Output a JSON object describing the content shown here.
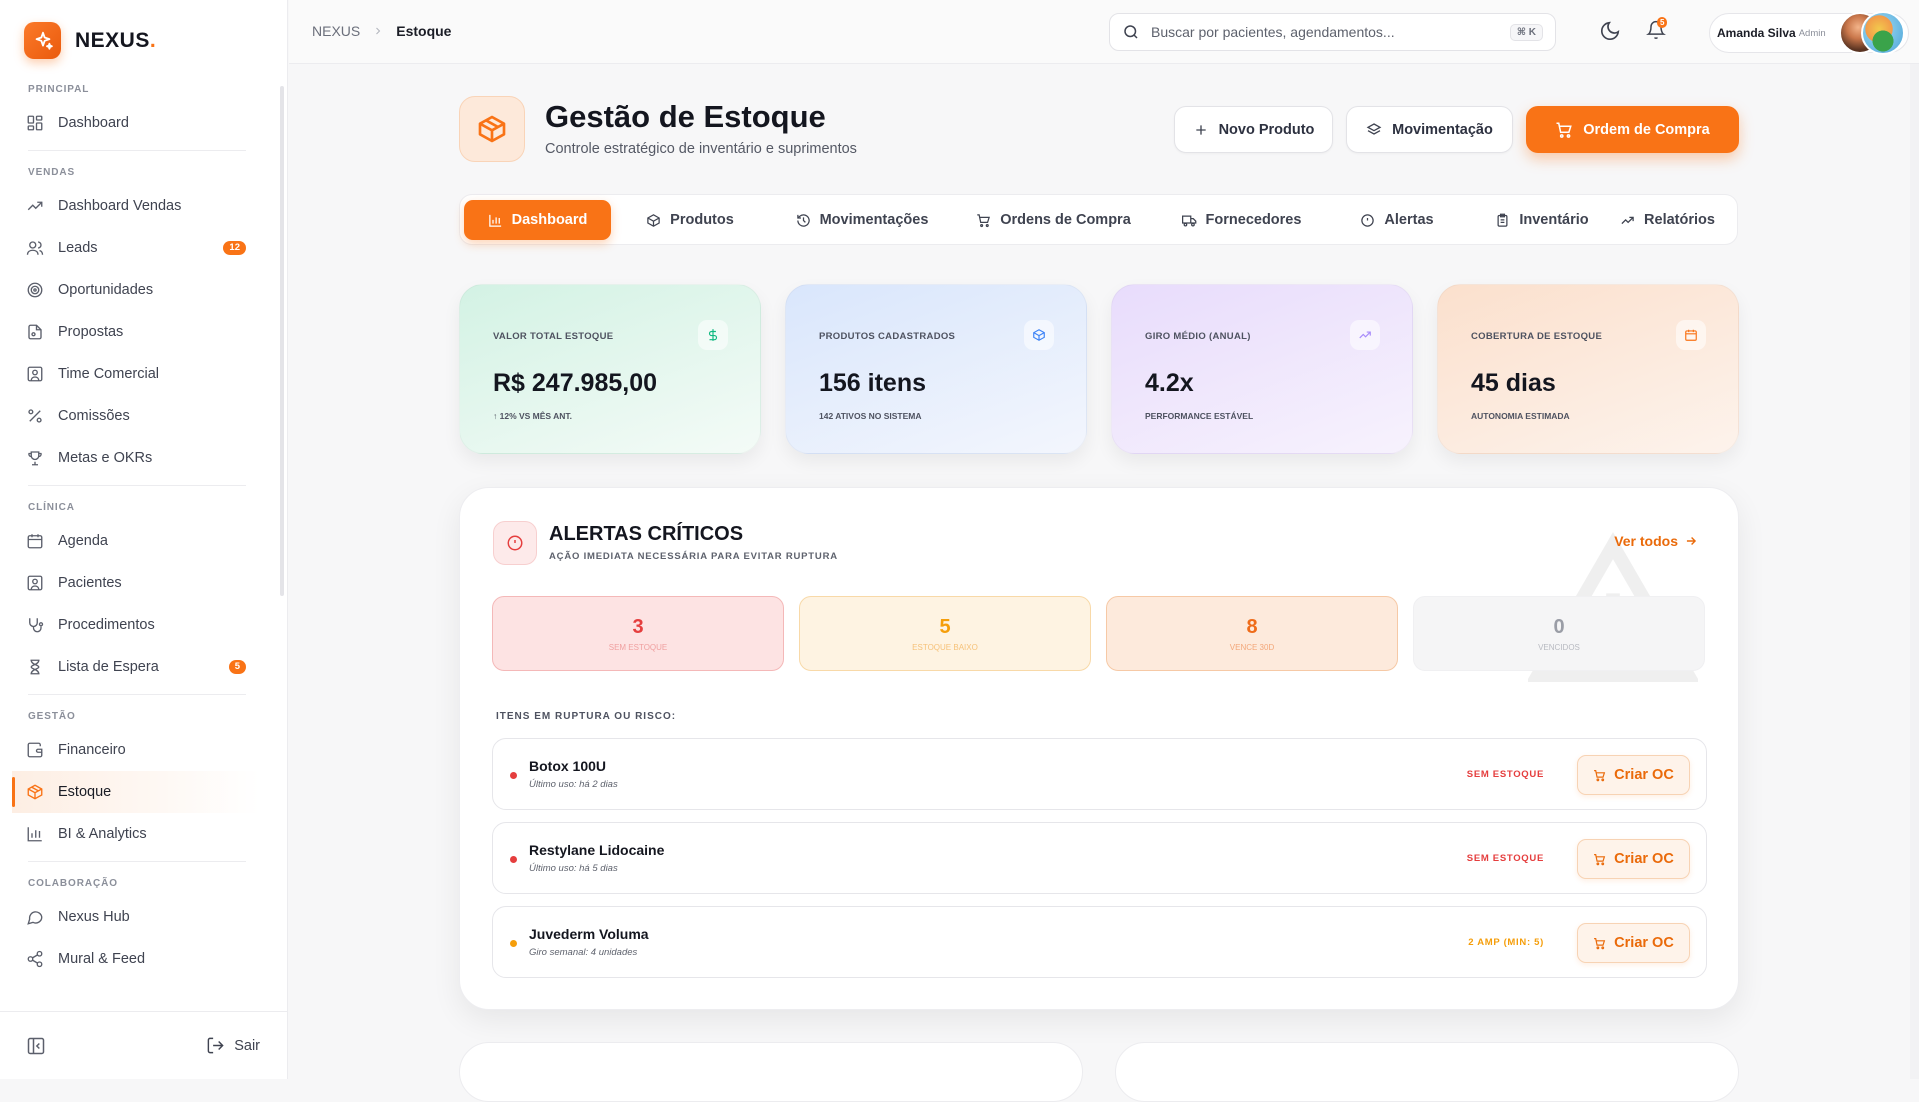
{
  "brand": {
    "name": "NEXUS",
    "dot": "."
  },
  "sidebar": {
    "sections": [
      {
        "label": "PRINCIPAL",
        "items": [
          {
            "label": "Dashboard",
            "icon": "dashboard-icon"
          }
        ]
      },
      {
        "label": "VENDAS",
        "items": [
          {
            "label": "Dashboard Vendas",
            "icon": "trending-up-icon"
          },
          {
            "label": "Leads",
            "icon": "users-icon",
            "badge": "12"
          },
          {
            "label": "Oportunidades",
            "icon": "target-icon"
          },
          {
            "label": "Propostas",
            "icon": "file-icon"
          },
          {
            "label": "Time Comercial",
            "icon": "contact-icon"
          },
          {
            "label": "Comissões",
            "icon": "percent-icon"
          },
          {
            "label": "Metas e OKRs",
            "icon": "trophy-icon"
          }
        ]
      },
      {
        "label": "CLÍNICA",
        "items": [
          {
            "label": "Agenda",
            "icon": "calendar-icon"
          },
          {
            "label": "Pacientes",
            "icon": "contact-icon"
          },
          {
            "label": "Procedimentos",
            "icon": "stethoscope-icon"
          },
          {
            "label": "Lista de Espera",
            "icon": "hourglass-icon",
            "badge": "5"
          }
        ]
      },
      {
        "label": "GESTÃO",
        "items": [
          {
            "label": "Financeiro",
            "icon": "wallet-icon"
          },
          {
            "label": "Estoque",
            "icon": "box-icon",
            "active": true
          },
          {
            "label": "BI & Analytics",
            "icon": "bar-chart-icon"
          }
        ]
      },
      {
        "label": "COLABORAÇÃO",
        "items": [
          {
            "label": "Nexus Hub",
            "icon": "chat-icon"
          },
          {
            "label": "Mural & Feed",
            "icon": "share-icon"
          }
        ]
      }
    ],
    "logout": "Sair"
  },
  "topbar": {
    "breadcrumb": [
      "NEXUS",
      "Estoque"
    ],
    "search_placeholder": "Buscar por pacientes, agendamentos...",
    "shortcut": "⌘ K",
    "notifications": "5",
    "user": {
      "name": "Amanda Silva",
      "role": "Admin"
    }
  },
  "page": {
    "title": "Gestão de Estoque",
    "subtitle": "Controle estratégico de inventário e suprimentos",
    "buttons": {
      "new_product": "Novo Produto",
      "movement": "Movimentação",
      "purchase_order": "Ordem de Compra"
    }
  },
  "tabs": [
    "Dashboard",
    "Produtos",
    "Movimentações",
    "Ordens de Compra",
    "Fornecedores",
    "Alertas",
    "Inventário",
    "Relatórios"
  ],
  "kpis": [
    {
      "label": "VALOR TOTAL ESTOQUE",
      "value": "R$ 247.985,00",
      "sub": "↑ 12% VS MÊS ANT.",
      "icon": "dollar-icon",
      "color": "#10b981"
    },
    {
      "label": "PRODUTOS CADASTRADOS",
      "value": "156 itens",
      "sub": "142 ATIVOS NO SISTEMA",
      "icon": "package-icon",
      "color": "#3b82f6"
    },
    {
      "label": "GIRO MÉDIO (ANUAL)",
      "value": "4.2x",
      "sub": "PERFORMANCE ESTÁVEL",
      "icon": "trending-icon",
      "color": "#a78bfa"
    },
    {
      "label": "COBERTURA DE ESTOQUE",
      "value": "45 dias",
      "sub": "AUTONOMIA ESTIMADA",
      "icon": "calendar-icon",
      "color": "#f97316"
    }
  ],
  "alerts": {
    "title": "ALERTAS CRÍTICOS",
    "subtitle": "AÇÃO IMEDIATA NECESSÁRIA PARA EVITAR RUPTURA",
    "view_all": "Ver todos",
    "stats": [
      {
        "value": "3",
        "label": "SEM ESTOQUE"
      },
      {
        "value": "5",
        "label": "ESTOQUE BAIXO"
      },
      {
        "value": "8",
        "label": "VENCE 30D"
      },
      {
        "value": "0",
        "label": "VENCIDOS"
      }
    ],
    "risk_heading": "ITENS EM RUPTURA OU RISCO:",
    "items": [
      {
        "name": "Botox 100U",
        "detail": "Último uso: há 2 dias",
        "status": "SEM ESTOQUE",
        "action": "Criar OC"
      },
      {
        "name": "Restylane Lidocaine",
        "detail": "Último uso: há 5 dias",
        "status": "SEM ESTOQUE",
        "action": "Criar OC"
      },
      {
        "name": "Juvederm Voluma",
        "detail": "Giro semanal: 4 unidades",
        "status": "2 AMP (MIN: 5)",
        "action": "Criar OC"
      }
    ]
  },
  "colors": {
    "accent": "#f97316",
    "danger": "#e53e3e",
    "warning": "#f59e0b"
  }
}
